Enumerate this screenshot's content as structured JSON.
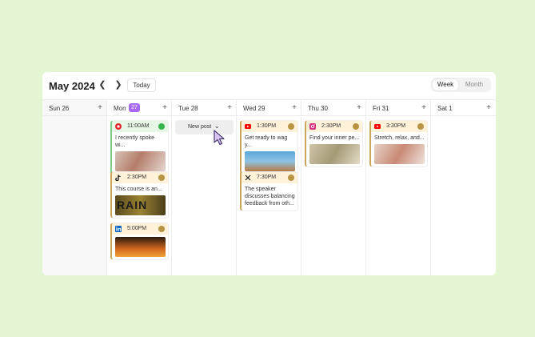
{
  "header": {
    "month_title": "May 2024",
    "today_label": "Today",
    "view_options": [
      "Week",
      "Month"
    ],
    "active_view": "Week"
  },
  "days": [
    {
      "label": "Sun 26"
    },
    {
      "label": "Mon",
      "badge": "27"
    },
    {
      "label": "Tue 28"
    },
    {
      "label": "Wed 29"
    },
    {
      "label": "Thu 30"
    },
    {
      "label": "Fri 31"
    },
    {
      "label": "Sat 1"
    }
  ],
  "add_symbol": "+",
  "new_post": {
    "label": "New post",
    "chevron": "⌄"
  },
  "posts": {
    "mon_1": {
      "time": "11:00AM",
      "text": "I recently spoke wi...",
      "platform": "pinterest-icon",
      "status": "published"
    },
    "mon_2": {
      "time": "2:30PM",
      "text": "This course is an...",
      "platform": "tiktok-icon",
      "status": "scheduled",
      "image_text": "RAIN"
    },
    "mon_3": {
      "time": "5:00PM",
      "platform": "linkedin-icon",
      "status": "scheduled"
    },
    "wed_1": {
      "time": "1:30PM",
      "text": "Get ready to wag y...",
      "platform": "youtube-icon",
      "status": "scheduled"
    },
    "wed_2": {
      "time": "7:30PM",
      "text": "The speaker discusses balancing feedback from oth...",
      "platform": "x-icon",
      "status": "scheduled"
    },
    "thu_1": {
      "time": "2:30PM",
      "text": "Find your inner pe...",
      "platform": "instagram-icon",
      "status": "scheduled"
    },
    "fri_1": {
      "time": "3:30PM",
      "text": "Stretch, relax, and...",
      "platform": "youtube-icon",
      "status": "scheduled"
    }
  },
  "colors": {
    "today_badge": "#a768f2",
    "published_accent": "#7cc98a",
    "scheduled_accent": "#c9a65a",
    "background": "#e4f5d4"
  }
}
